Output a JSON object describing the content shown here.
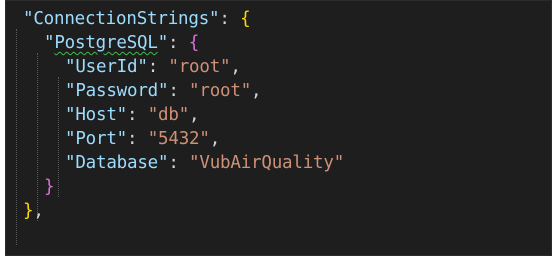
{
  "lines": [
    {
      "key": "\"ConnectionStrings\"",
      "sep": ": ",
      "open": "{"
    },
    {
      "key_q1": "\"",
      "key_word": "PostgreSQL",
      "key_q2": "\"",
      "sep": ": ",
      "open": "{"
    },
    {
      "key": "\"UserId\"",
      "sep": ": ",
      "value": "\"root\"",
      "end": ","
    },
    {
      "key": "\"Password\"",
      "sep": ": ",
      "value": "\"root\"",
      "end": ","
    },
    {
      "key": "\"Host\"",
      "sep": ": ",
      "value": "\"db\"",
      "end": ","
    },
    {
      "key": "\"Port\"",
      "sep": ": ",
      "value": "\"5432\"",
      "end": ","
    },
    {
      "key": "\"Database\"",
      "sep": ": ",
      "value": "\"VubAirQuality\""
    },
    {
      "close": "}"
    },
    {
      "close": "}",
      "end": ","
    }
  ],
  "colors": {
    "background": "#1e1e1e",
    "json_key": "#9cdcfe",
    "json_string": "#ce9178",
    "punctuation": "#d4d4d4",
    "bracket_level1": "#ffd700",
    "bracket_level2": "#da70d6",
    "spelling_squiggle": "#3fb950"
  }
}
